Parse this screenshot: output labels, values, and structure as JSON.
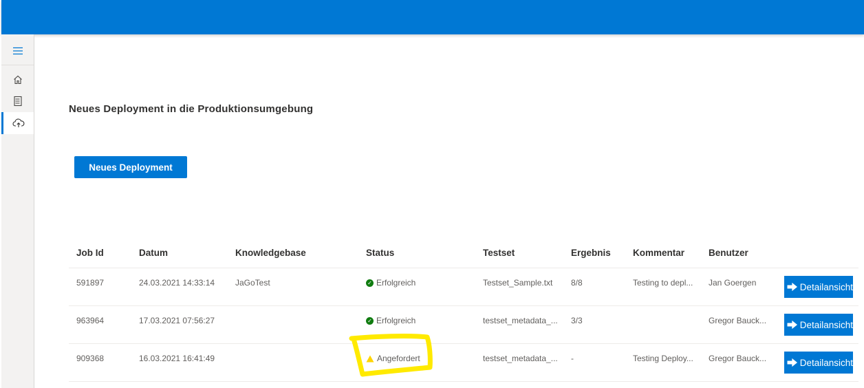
{
  "sidebar": {
    "items": [
      {
        "icon": "hamburger-icon"
      },
      {
        "icon": "home-icon"
      },
      {
        "icon": "report-icon"
      },
      {
        "icon": "cloud-upload-icon",
        "active": true
      }
    ]
  },
  "page": {
    "title": "Neues Deployment in die Produktionsumgebung",
    "new_button_label": "Neues Deployment"
  },
  "table": {
    "headers": [
      "Job Id",
      "Datum",
      "Knowledgebase",
      "Status",
      "Testset",
      "Ergebnis",
      "Kommentar",
      "Benutzer"
    ],
    "rows": [
      {
        "job_id": "591897",
        "datum": "24.03.2021 14:33:14",
        "knowledgebase": "JaGoTest",
        "status": "Erfolgreich",
        "status_type": "success",
        "testset": "Testset_Sample.txt",
        "ergebnis": "8/8",
        "kommentar": "Testing to depl...",
        "benutzer": "Jan Goergen",
        "action": "Detailansicht"
      },
      {
        "job_id": "963964",
        "datum": "17.03.2021 07:56:27",
        "knowledgebase": "",
        "status": "Erfolgreich",
        "status_type": "success",
        "testset": "testset_metadata_...",
        "ergebnis": "3/3",
        "kommentar": "",
        "benutzer": "Gregor Bauck...",
        "action": "Detailansicht"
      },
      {
        "job_id": "909368",
        "datum": "16.03.2021 16:41:49",
        "knowledgebase": "",
        "status": "Angefordert",
        "status_type": "warning",
        "testset": "testset_metadata_...",
        "ergebnis": "-",
        "kommentar": "Testing Deploy...",
        "benutzer": "Gregor Bauck...",
        "action": "Detailansicht"
      }
    ]
  },
  "colors": {
    "primary": "#0078d4",
    "success": "#107c10",
    "warning": "#ffd400",
    "highlight": "#ffea00"
  }
}
